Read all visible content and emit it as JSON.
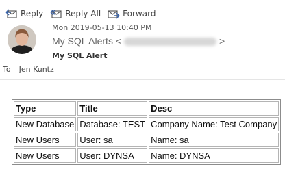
{
  "toolbar": {
    "reply": "Reply",
    "reply_all": "Reply All",
    "forward": "Forward"
  },
  "message": {
    "date": "Mon 2019-05-13 10:40 PM",
    "from_name": "My SQL Alerts",
    "addr_open": "<",
    "addr_close": ">",
    "subject": "My SQL Alert",
    "to_label": "To",
    "to_name": "Jen Kuntz"
  },
  "table": {
    "headers": [
      "Type",
      "Title",
      "Desc"
    ],
    "rows": [
      [
        "New Database",
        "Database: TEST",
        "Company Name: Test Company"
      ],
      [
        "New Users",
        "User: sa",
        "Name: sa"
      ],
      [
        "New Users",
        "User: DYNSA",
        "Name: DYNSA"
      ]
    ]
  },
  "colors": {
    "icon": "#5a5a5a",
    "text": "#222222"
  }
}
